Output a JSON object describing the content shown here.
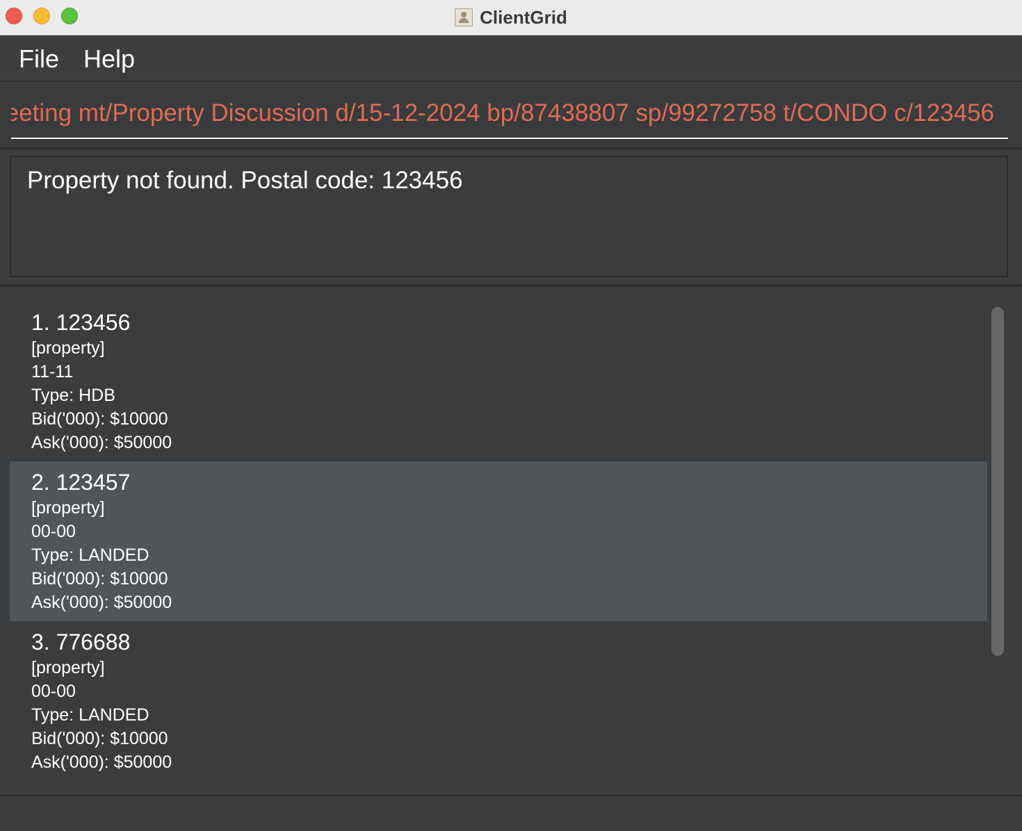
{
  "window": {
    "title": "ClientGrid",
    "app_icon": "address-book-icon"
  },
  "menu": {
    "items": [
      {
        "label": "File"
      },
      {
        "label": "Help"
      }
    ]
  },
  "command_box": {
    "value": "ıeeting mt/Property Discussion d/15-12-2024 bp/87438807 sp/99272758 t/CONDO c/123456",
    "text_color": "#df6b52"
  },
  "result_display": {
    "message": "Property not found. Postal code: 123456"
  },
  "property_list": {
    "items": [
      {
        "title": "1. 123456",
        "tag": "[property]",
        "unit": "11-11",
        "type": "Type: HDB",
        "bid": "Bid('000): $10000",
        "ask": "Ask('000): $50000",
        "selected": false
      },
      {
        "title": "2. 123457",
        "tag": "[property]",
        "unit": "00-00",
        "type": "Type: LANDED",
        "bid": "Bid('000): $10000",
        "ask": "Ask('000): $50000",
        "selected": true
      },
      {
        "title": "3. 776688",
        "tag": "[property]",
        "unit": "00-00",
        "type": "Type: LANDED",
        "bid": "Bid('000): $10000",
        "ask": "Ask('000): $50000",
        "selected": false
      }
    ]
  },
  "colors": {
    "background": "#3c3d3f",
    "selected_row": "#4f5559",
    "command_text": "#df6b52"
  }
}
